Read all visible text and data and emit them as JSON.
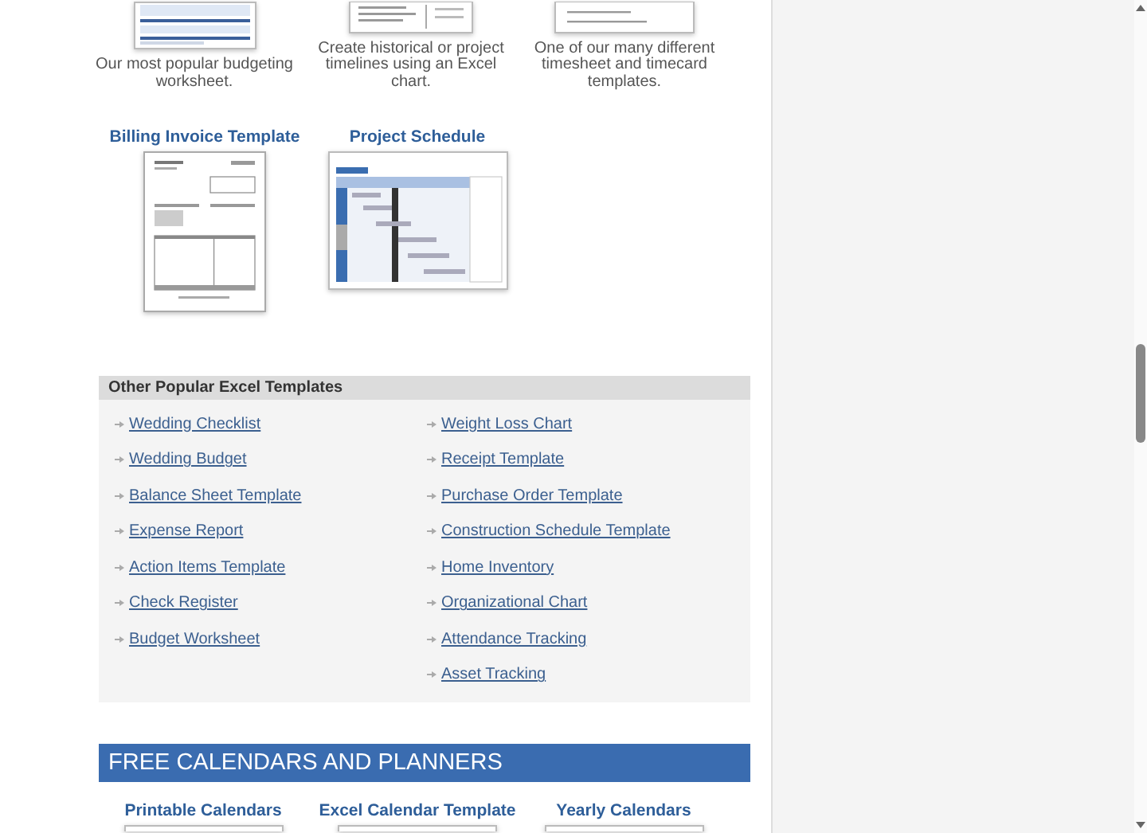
{
  "featured_top": [
    {
      "kind": "budget",
      "caption": "Our most popular budgeting worksheet."
    },
    {
      "kind": "timeline",
      "caption": "Create historical or project timelines using an Excel chart."
    },
    {
      "kind": "timesheet",
      "caption": "One of our many different timesheet and timecard templates."
    }
  ],
  "featured": [
    {
      "title": "Billing Invoice Template",
      "kind": "invoice"
    },
    {
      "title": "Project Schedule",
      "kind": "gantt"
    }
  ],
  "other_popular": {
    "title": "Other Popular Excel Templates",
    "columns": [
      [
        "Wedding Checklist",
        "Wedding Budget",
        "Balance Sheet Template",
        "Expense Report",
        "Action Items Template",
        "Check Register",
        "Budget Worksheet"
      ],
      [
        "Weight Loss Chart",
        "Receipt Template",
        "Purchase Order Template",
        "Construction Schedule Template",
        "Home Inventory",
        "Organizational Chart",
        "Attendance Tracking",
        "Asset Tracking"
      ]
    ]
  },
  "calendars": {
    "title": "FREE CALENDARS AND PLANNERS",
    "items": [
      {
        "title": "Printable Calendars"
      },
      {
        "title": "Excel Calendar Template"
      },
      {
        "title": "Yearly Calendars"
      }
    ]
  }
}
